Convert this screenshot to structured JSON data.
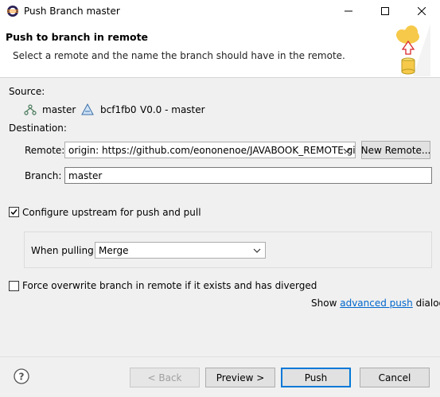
{
  "window": {
    "title": "Push Branch master"
  },
  "header": {
    "title": "Push to branch in remote",
    "description": "Select a remote and the name the branch should have in the remote."
  },
  "source": {
    "label": "Source:",
    "branch": "master",
    "commit_id": "bcf1fb0",
    "commit_message": "V0.0 - master"
  },
  "destination": {
    "label": "Destination:",
    "remote_label": "Remote:",
    "remote_value": "origin: https://github.com/eononenoe/JAVABOOK_REMOTE.git",
    "new_remote_button": "New Remote...",
    "branch_label": "Branch:",
    "branch_value": "master"
  },
  "upstream": {
    "checkbox_label": "Configure upstream for push and pull",
    "checked": true,
    "when_pulling_label": "When pulling:",
    "when_pulling_value": "Merge"
  },
  "force": {
    "checkbox_label": "Force overwrite branch in remote if it exists and has diverged",
    "checked": false
  },
  "advanced": {
    "prefix": "Show",
    "link": "advanced push",
    "suffix": "dialog"
  },
  "buttons": {
    "back": "< Back",
    "preview": "Preview >",
    "push": "Push",
    "cancel": "Cancel"
  },
  "icons": {
    "help": "help-icon",
    "branch": "branch-icon",
    "commit": "commit-icon",
    "banner": "cloud-push-icon"
  },
  "colors": {
    "link": "#0066cc",
    "default_button_border": "#0078d7",
    "banner_arrow": "#d9262a"
  }
}
